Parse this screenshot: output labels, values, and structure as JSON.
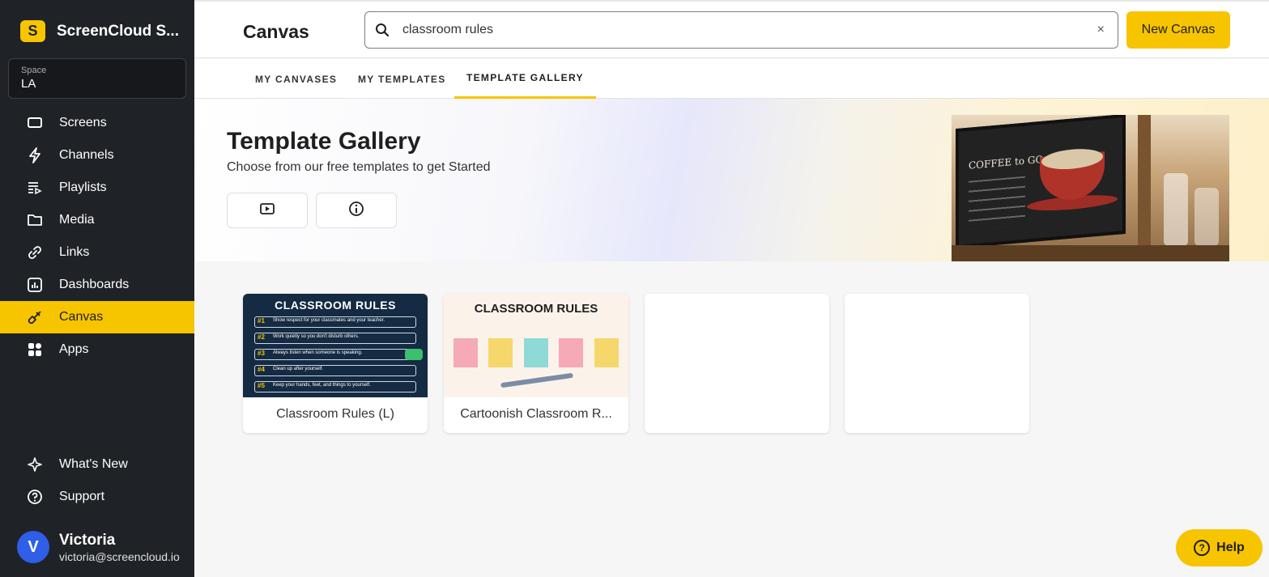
{
  "sidebar": {
    "brand_letter": "S",
    "brand_name": "ScreenCloud S...",
    "space_label": "Space",
    "space_value": "LA",
    "items": [
      {
        "label": "Screens",
        "icon": "screen-icon"
      },
      {
        "label": "Channels",
        "icon": "lightning-icon"
      },
      {
        "label": "Playlists",
        "icon": "playlist-icon"
      },
      {
        "label": "Media",
        "icon": "folder-icon"
      },
      {
        "label": "Links",
        "icon": "link-icon"
      },
      {
        "label": "Dashboards",
        "icon": "dashboard-icon"
      },
      {
        "label": "Canvas",
        "icon": "brush-icon",
        "active": true
      },
      {
        "label": "Apps",
        "icon": "apps-icon"
      }
    ],
    "bottom_items": [
      {
        "label": "What's New",
        "icon": "sparkle-icon"
      },
      {
        "label": "Support",
        "icon": "question-icon"
      }
    ],
    "user": {
      "initial": "V",
      "name": "Victoria",
      "email": "victoria@screencloud.io"
    }
  },
  "header": {
    "title": "Canvas",
    "search_value": "classroom rules",
    "clear_label": "×",
    "new_button": "New Canvas"
  },
  "tabs": [
    {
      "label": "MY CANVASES"
    },
    {
      "label": "MY TEMPLATES"
    },
    {
      "label": "TEMPLATE GALLERY",
      "active": true
    }
  ],
  "banner": {
    "title": "Template Gallery",
    "subtitle": "Choose from our free templates to get Started",
    "photo_text": "COFFEE to GO"
  },
  "templates": [
    {
      "label": "Classroom Rules (L)",
      "thumb_title": "CLASSROOM RULES",
      "rules": [
        {
          "num": "#1",
          "text": "Show respect for your classmates and your teacher."
        },
        {
          "num": "#2",
          "text": "Work quietly so you don't disturb others."
        },
        {
          "num": "#3",
          "text": "Always listen when someone is speaking."
        },
        {
          "num": "#4",
          "text": "Clean up after yourself."
        },
        {
          "num": "#5",
          "text": "Keep your hands, feet, and things to yourself."
        }
      ]
    },
    {
      "label": "Cartoonish Classroom R...",
      "thumb_title": "CLASSROOM RULES"
    },
    {
      "label": ""
    },
    {
      "label": ""
    }
  ],
  "help": {
    "label": "Help"
  },
  "colors": {
    "accent": "#f7c400",
    "sidebar_bg": "#1f2227",
    "avatar": "#2f5ee8"
  }
}
